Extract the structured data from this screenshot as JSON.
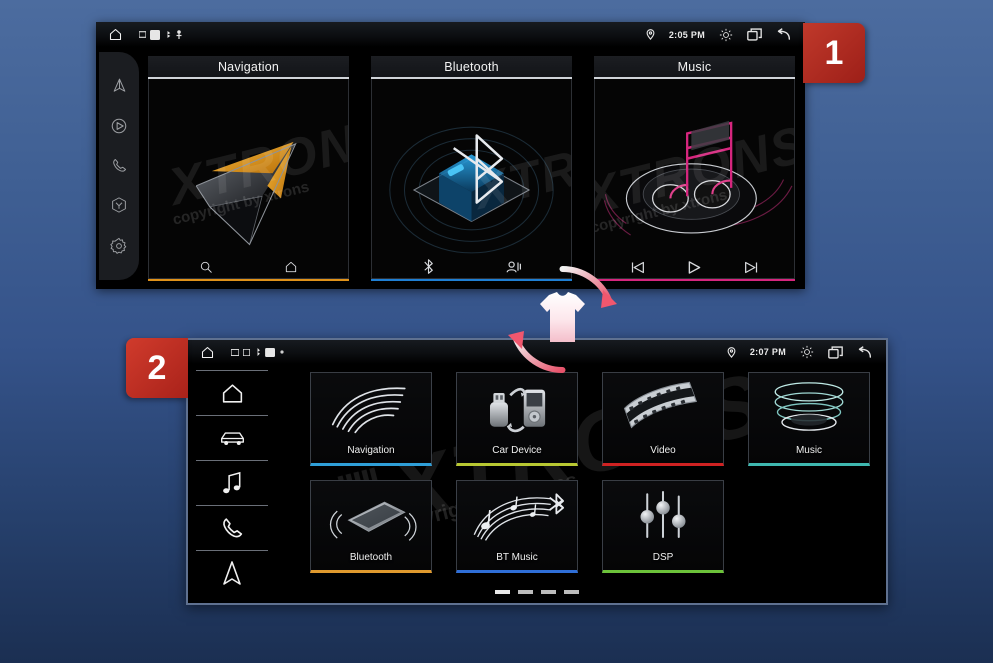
{
  "background": {
    "top_color": "#4c6c9f",
    "bottom_color": "#1b2f52"
  },
  "badges": [
    {
      "name": "step-1",
      "label": "1",
      "color": "#b02a22"
    },
    {
      "name": "step-2",
      "label": "2",
      "color": "#c0362a"
    }
  ],
  "swap_icon": {
    "name": "theme-swap-icon",
    "glyph": "t-shirt-with-refresh-arrows",
    "color": "#e8536b"
  },
  "watermark": {
    "brand": "XTRONS",
    "registered": "®",
    "copyright": "copyright by xtrons"
  },
  "screen1": {
    "statusbar": {
      "home_icon": "home-icon",
      "tray_icons": [
        "sd-card-icon",
        "app-icon",
        "bluetooth-dot-icon",
        "gps-icon"
      ],
      "location_icon": "location-pin-icon",
      "time": "2:05 PM",
      "brightness_icon": "brightness-icon",
      "recents_icon": "recent-apps-icon",
      "back_icon": "back-arrow-icon"
    },
    "sidebar": [
      {
        "name": "sidebar-item-navigation",
        "icon": "navigation-arrow-icon"
      },
      {
        "name": "sidebar-item-media",
        "icon": "play-circle-icon"
      },
      {
        "name": "sidebar-item-phone",
        "icon": "phone-icon"
      },
      {
        "name": "sidebar-item-apps",
        "icon": "cube-icon"
      },
      {
        "name": "sidebar-item-settings",
        "icon": "gear-icon"
      }
    ],
    "cards": [
      {
        "name": "card-navigation",
        "title": "Navigation",
        "accent": "#e0921a",
        "art": "paper-plane-navigation-art",
        "controls": [
          {
            "name": "search-icon",
            "glyph": "search"
          },
          {
            "name": "home-icon",
            "glyph": "home"
          }
        ]
      },
      {
        "name": "card-bluetooth",
        "title": "Bluetooth",
        "accent": "#1f7fd4",
        "art": "bluetooth-cube-art",
        "controls": [
          {
            "name": "bluetooth-icon",
            "glyph": "bluetooth"
          },
          {
            "name": "contacts-icon",
            "glyph": "contacts"
          }
        ]
      },
      {
        "name": "card-music",
        "title": "Music",
        "accent": "#d6267e",
        "art": "music-note-disc-art",
        "controls": [
          {
            "name": "previous-track-button",
            "glyph": "prev"
          },
          {
            "name": "play-button",
            "glyph": "play"
          },
          {
            "name": "next-track-button",
            "glyph": "next"
          }
        ]
      }
    ]
  },
  "screen2": {
    "statusbar": {
      "home_icon": "home-icon",
      "tray_icons": [
        "sd-card-icon",
        "app-icon",
        "bluetooth-dot-icon",
        "battery-icon",
        "dot-icon"
      ],
      "location_icon": "location-pin-icon",
      "time": "2:07 PM",
      "brightness_icon": "brightness-icon",
      "recents_icon": "recent-apps-icon",
      "back_icon": "back-arrow-icon"
    },
    "sidebar": [
      {
        "name": "sidebar-item-home",
        "icon": "home-icon"
      },
      {
        "name": "sidebar-item-car",
        "icon": "car-icon"
      },
      {
        "name": "sidebar-item-music",
        "icon": "music-note-icon"
      },
      {
        "name": "sidebar-item-phone",
        "icon": "phone-icon"
      },
      {
        "name": "sidebar-item-navigation",
        "icon": "navigation-arrow-icon"
      }
    ],
    "tiles": [
      {
        "name": "tile-navigation",
        "label": "Navigation",
        "accent": "#2f9fd8",
        "art": "swoosh-lines-art"
      },
      {
        "name": "tile-car-device",
        "label": "Car Device",
        "accent": "#b8c832",
        "art": "usb-and-player-art"
      },
      {
        "name": "tile-video",
        "label": "Video",
        "accent": "#cf2222",
        "art": "film-strip-art"
      },
      {
        "name": "tile-music",
        "label": "Music",
        "accent": "#3fb8b0",
        "art": "disc-rings-art"
      },
      {
        "name": "tile-bluetooth",
        "label": "Bluetooth",
        "accent": "#e09a2e",
        "art": "phone-waves-art"
      },
      {
        "name": "tile-bt-music",
        "label": "BT Music",
        "accent": "#2f6fd8",
        "art": "notes-staff-bluetooth-art"
      },
      {
        "name": "tile-dsp",
        "label": "DSP",
        "accent": "#6cc23a",
        "art": "equalizer-sliders-art"
      }
    ],
    "page_dots": {
      "count": 4,
      "active_index": 0
    }
  }
}
